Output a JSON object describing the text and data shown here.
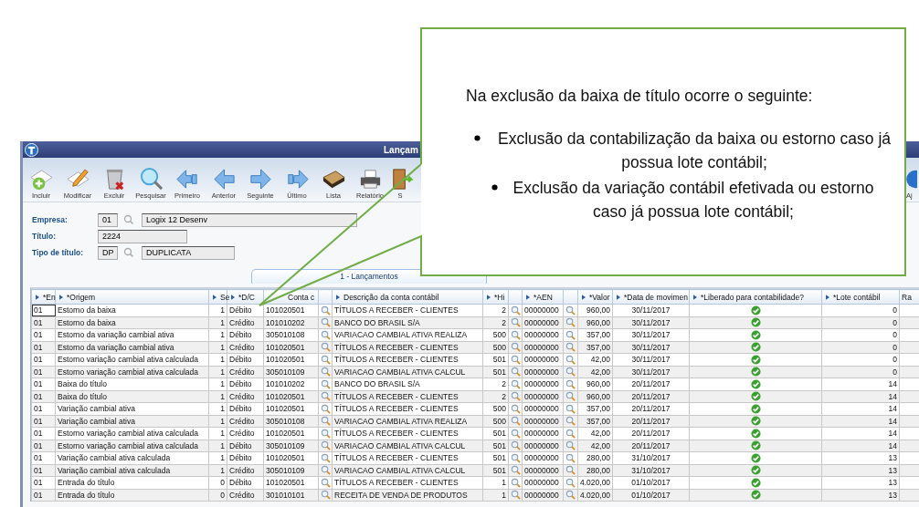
{
  "window": {
    "title": "Lançam"
  },
  "toolbar": [
    {
      "label": "Incluir",
      "kind": "add"
    },
    {
      "label": "Modificar",
      "kind": "edit"
    },
    {
      "label": "Excluir",
      "kind": "delete"
    },
    {
      "label": "Pesquisar",
      "kind": "search"
    },
    {
      "label": "Primeiro",
      "kind": "first"
    },
    {
      "label": "Anterior",
      "kind": "prev"
    },
    {
      "label": "Seguinte",
      "kind": "next"
    },
    {
      "label": "Último",
      "kind": "last"
    },
    {
      "label": "Lista",
      "kind": "list"
    },
    {
      "label": "Relatório",
      "kind": "report"
    },
    {
      "label": "S",
      "kind": "exit"
    },
    {
      "label": "Aj",
      "kind": "help"
    }
  ],
  "form": [
    {
      "label": "Empresa:",
      "kind": "lookup",
      "code": "01",
      "value": "Logix 12 Desenv"
    },
    {
      "label": "Título:",
      "kind": "text",
      "value": "2224"
    },
    {
      "label": "Tipo de título:",
      "kind": "lookup",
      "code": "DP",
      "value": "DUPLICATA"
    }
  ],
  "tabs": [
    {
      "label": "1 - Lançamentos",
      "selected": true
    }
  ],
  "table": {
    "columns": [
      {
        "label": "*En",
        "arrow": true
      },
      {
        "label": "*Origem",
        "arrow": true
      },
      {
        "label": "Se",
        "arrow": true
      },
      {
        "label": "*D/C",
        "arrow": true
      },
      {
        "label": "Conta c",
        "arrow": false
      },
      {
        "arrow": false
      },
      {
        "label": "Descrição da conta contábil",
        "arrow": true
      },
      {
        "label": "*Hi",
        "arrow": true
      },
      {
        "arrow": false
      },
      {
        "label": "*AEN",
        "arrow": true
      },
      {
        "arrow": false
      },
      {
        "label": "*Valor",
        "arrow": true
      },
      {
        "label": "*Data de movimen",
        "arrow": true
      },
      {
        "label": "*Liberado para contabilidade?",
        "arrow": true
      },
      {
        "label": "*Lote contábil",
        "arrow": true
      },
      {
        "label": "Ra",
        "arrow": false
      }
    ],
    "rows": [
      {
        "selected": true,
        "empresa": "01",
        "origem": "Estorno da baixa",
        "seq": "1",
        "dc": "Débito",
        "conta": "101020501",
        "descricao": "TÍTULOS A RECEBER - CLIENTES",
        "historico": "2",
        "aen": "00000000",
        "valor": "960,00",
        "data": "30/11/2017",
        "liberado": true,
        "lote": "0"
      },
      {
        "selected": false,
        "empresa": "01",
        "origem": "Estorno da baixa",
        "seq": "1",
        "dc": "Crédito",
        "conta": "101010202",
        "descricao": "BANCO DO BRASIL S/A",
        "historico": "2",
        "aen": "00000000",
        "valor": "960,00",
        "data": "30/11/2017",
        "liberado": true,
        "lote": "0"
      },
      {
        "selected": false,
        "empresa": "01",
        "origem": "Estorno da variação cambial ativa",
        "seq": "1",
        "dc": "Débito",
        "conta": "305010108",
        "descricao": "VARIACAO CAMBIAL ATIVA REALIZA",
        "historico": "500",
        "aen": "00000000",
        "valor": "357,00",
        "data": "30/11/2017",
        "liberado": true,
        "lote": "0"
      },
      {
        "selected": false,
        "empresa": "01",
        "origem": "Estorno da variação cambial ativa",
        "seq": "1",
        "dc": "Crédito",
        "conta": "101020501",
        "descricao": "TÍTULOS A RECEBER - CLIENTES",
        "historico": "500",
        "aen": "00000000",
        "valor": "357,00",
        "data": "30/11/2017",
        "liberado": true,
        "lote": "0"
      },
      {
        "selected": false,
        "empresa": "01",
        "origem": "Estorno variação cambial ativa calculada",
        "seq": "1",
        "dc": "Débito",
        "conta": "101020501",
        "descricao": "TÍTULOS A RECEBER - CLIENTES",
        "historico": "501",
        "aen": "00000000",
        "valor": "42,00",
        "data": "30/11/2017",
        "liberado": true,
        "lote": "0"
      },
      {
        "selected": false,
        "empresa": "01",
        "origem": "Estorno variação cambial ativa calculada",
        "seq": "1",
        "dc": "Crédito",
        "conta": "305010109",
        "descricao": "VARIACAO CAMBIAL ATIVA CALCUL",
        "historico": "501",
        "aen": "00000000",
        "valor": "42,00",
        "data": "30/11/2017",
        "liberado": true,
        "lote": "0"
      },
      {
        "selected": false,
        "empresa": "01",
        "origem": "Baixa do título",
        "seq": "1",
        "dc": "Débito",
        "conta": "101010202",
        "descricao": "BANCO DO BRASIL S/A",
        "historico": "2",
        "aen": "00000000",
        "valor": "960,00",
        "data": "20/11/2017",
        "liberado": true,
        "lote": "14"
      },
      {
        "selected": false,
        "empresa": "01",
        "origem": "Baixa do título",
        "seq": "1",
        "dc": "Crédito",
        "conta": "101020501",
        "descricao": "TÍTULOS A RECEBER - CLIENTES",
        "historico": "2",
        "aen": "00000000",
        "valor": "960,00",
        "data": "20/11/2017",
        "liberado": true,
        "lote": "14"
      },
      {
        "selected": false,
        "empresa": "01",
        "origem": "Variação cambial ativa",
        "seq": "1",
        "dc": "Débito",
        "conta": "101020501",
        "descricao": "TÍTULOS A RECEBER - CLIENTES",
        "historico": "500",
        "aen": "00000000",
        "valor": "357,00",
        "data": "20/11/2017",
        "liberado": true,
        "lote": "14"
      },
      {
        "selected": false,
        "empresa": "01",
        "origem": "Variação cambial ativa",
        "seq": "1",
        "dc": "Crédito",
        "conta": "305010108",
        "descricao": "VARIACAO CAMBIAL ATIVA REALIZA",
        "historico": "500",
        "aen": "00000000",
        "valor": "357,00",
        "data": "20/11/2017",
        "liberado": true,
        "lote": "14"
      },
      {
        "selected": false,
        "empresa": "01",
        "origem": "Estorno variação cambial ativa calculada",
        "seq": "1",
        "dc": "Crédito",
        "conta": "101020501",
        "descricao": "TÍTULOS A RECEBER - CLIENTES",
        "historico": "501",
        "aen": "00000000",
        "valor": "42,00",
        "data": "20/11/2017",
        "liberado": true,
        "lote": "14"
      },
      {
        "selected": false,
        "empresa": "01",
        "origem": "Estorno variação cambial ativa calculada",
        "seq": "1",
        "dc": "Débito",
        "conta": "305010109",
        "descricao": "VARIACAO CAMBIAL ATIVA CALCUL",
        "historico": "501",
        "aen": "00000000",
        "valor": "42,00",
        "data": "20/11/2017",
        "liberado": true,
        "lote": "14"
      },
      {
        "selected": false,
        "empresa": "01",
        "origem": "Variação cambial ativa calculada",
        "seq": "1",
        "dc": "Débito",
        "conta": "101020501",
        "descricao": "TÍTULOS A RECEBER - CLIENTES",
        "historico": "501",
        "aen": "00000000",
        "valor": "280,00",
        "data": "31/10/2017",
        "liberado": true,
        "lote": "13"
      },
      {
        "selected": false,
        "empresa": "01",
        "origem": "Variação cambial ativa calculada",
        "seq": "1",
        "dc": "Crédito",
        "conta": "305010109",
        "descricao": "VARIACAO CAMBIAL ATIVA CALCUL",
        "historico": "501",
        "aen": "00000000",
        "valor": "280,00",
        "data": "31/10/2017",
        "liberado": true,
        "lote": "13"
      },
      {
        "selected": false,
        "empresa": "01",
        "origem": "Entrada do título",
        "seq": "0",
        "dc": "Débito",
        "conta": "101020501",
        "descricao": "TÍTULOS A RECEBER - CLIENTES",
        "historico": "1",
        "aen": "00000000",
        "valor": "4.020,00",
        "data": "01/10/2017",
        "liberado": true,
        "lote": "13"
      },
      {
        "selected": false,
        "empresa": "01",
        "origem": "Entrada do título",
        "seq": "0",
        "dc": "Crédito",
        "conta": "301010101",
        "descricao": "RECEITA DE VENDA DE PRODUTOS",
        "historico": "1",
        "aen": "00000000",
        "valor": "4.020,00",
        "data": "01/10/2017",
        "liberado": true,
        "lote": "13"
      }
    ]
  },
  "callout": {
    "heading": "Na exclusão da baixa de título ocorre o seguinte:",
    "bullets": [
      "Exclusão da contabilização da baixa ou estorno caso já possua lote contábil;",
      "Exclusão da variação contábil efetivada ou estorno caso já possua lote contábil;"
    ]
  }
}
